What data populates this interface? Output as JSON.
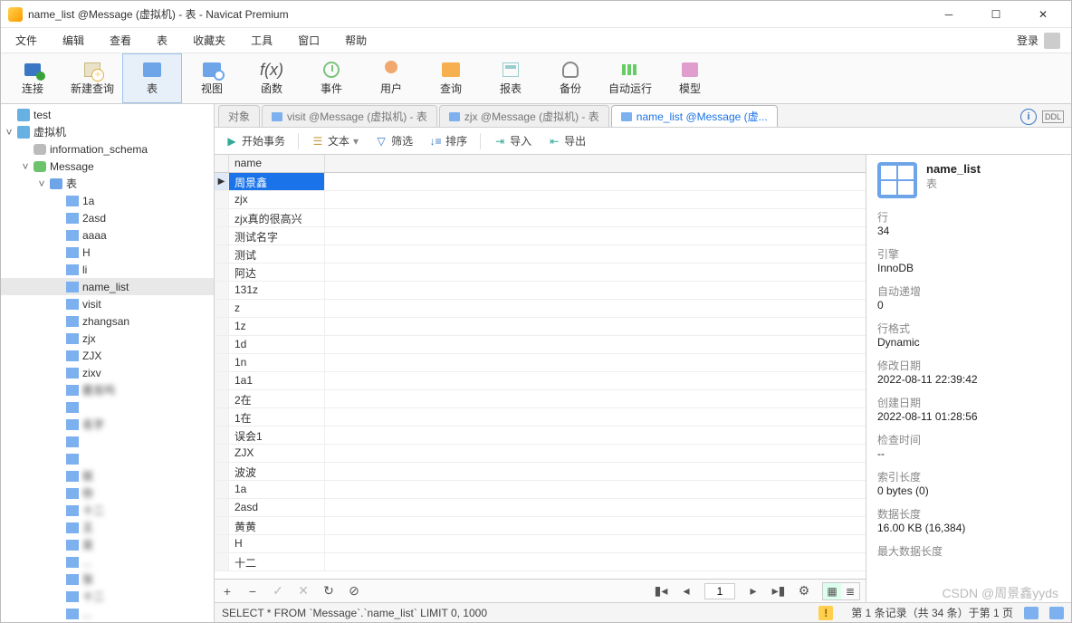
{
  "window": {
    "title": "name_list @Message (虚拟机) - 表 - Navicat Premium"
  },
  "menu": {
    "items": [
      "文件",
      "编辑",
      "查看",
      "表",
      "收藏夹",
      "工具",
      "窗口",
      "帮助"
    ],
    "login": "登录"
  },
  "toolbar": {
    "items": [
      {
        "id": "connect",
        "label": "连接"
      },
      {
        "id": "newquery",
        "label": "新建查询"
      },
      {
        "id": "table",
        "label": "表"
      },
      {
        "id": "view",
        "label": "视图"
      },
      {
        "id": "function",
        "label": "函数"
      },
      {
        "id": "event",
        "label": "事件"
      },
      {
        "id": "user",
        "label": "用户"
      },
      {
        "id": "query",
        "label": "查询"
      },
      {
        "id": "report",
        "label": "报表"
      },
      {
        "id": "backup",
        "label": "备份"
      },
      {
        "id": "auto",
        "label": "自动运行"
      },
      {
        "id": "model",
        "label": "模型"
      }
    ],
    "active_id": "table"
  },
  "tree": {
    "root1": "test",
    "root2": "虚拟机",
    "db1": "information_schema",
    "db2": "Message",
    "tables_label": "表",
    "tables": [
      "1a",
      "2asd",
      "aaaa",
      "H",
      "li",
      "name_list",
      "visit",
      "zhangsan",
      "zjx",
      "ZJX",
      "zixv"
    ],
    "selected_table": "name_list",
    "blurred": [
      "匿名吗",
      "  ",
      "名字",
      "  ",
      "  ",
      "就",
      "你",
      "十二",
      "王",
      "吴",
      "",
      "张",
      "十二",
      ""
    ]
  },
  "tabs": {
    "items": [
      {
        "label": "对象"
      },
      {
        "label": "visit @Message (虚拟机) - 表"
      },
      {
        "label": "zjx @Message (虚拟机) - 表"
      },
      {
        "label": "name_list @Message (虚..."
      }
    ],
    "active_index": 3
  },
  "subtoolbar": {
    "begin": "开始事务",
    "text": "文本",
    "filter": "筛选",
    "sort": "排序",
    "import": "导入",
    "export": "导出"
  },
  "grid": {
    "column": "name",
    "rows": [
      "周景鑫",
      "zjx",
      "zjx真的很高兴",
      "测试名字",
      "测试",
      "阿达",
      "131z",
      "z",
      "1z",
      "1d",
      "1n",
      "1a1",
      "2在",
      "1在",
      "误会1",
      "ZJX",
      "波波",
      "1a",
      "2asd",
      "黄黄",
      "H",
      "十二"
    ],
    "selected_index": 0,
    "page": "1"
  },
  "right": {
    "title": "name_list",
    "sub": "表",
    "kv": [
      {
        "k": "行",
        "v": "34"
      },
      {
        "k": "引擎",
        "v": "InnoDB"
      },
      {
        "k": "自动递增",
        "v": "0"
      },
      {
        "k": "行格式",
        "v": "Dynamic"
      },
      {
        "k": "修改日期",
        "v": "2022-08-11 22:39:42"
      },
      {
        "k": "创建日期",
        "v": "2022-08-11 01:28:56"
      },
      {
        "k": "检查时间",
        "v": "--"
      },
      {
        "k": "索引长度",
        "v": "0 bytes (0)"
      },
      {
        "k": "数据长度",
        "v": "16.00 KB (16,384)"
      },
      {
        "k": "最大数据长度",
        "v": ""
      }
    ]
  },
  "status": {
    "sql": "SELECT * FROM `Message`.`name_list` LIMIT 0, 1000",
    "record": "第 1 条记录（共 34 条）于第 1 页"
  },
  "watermark": "CSDN @周景鑫yyds"
}
